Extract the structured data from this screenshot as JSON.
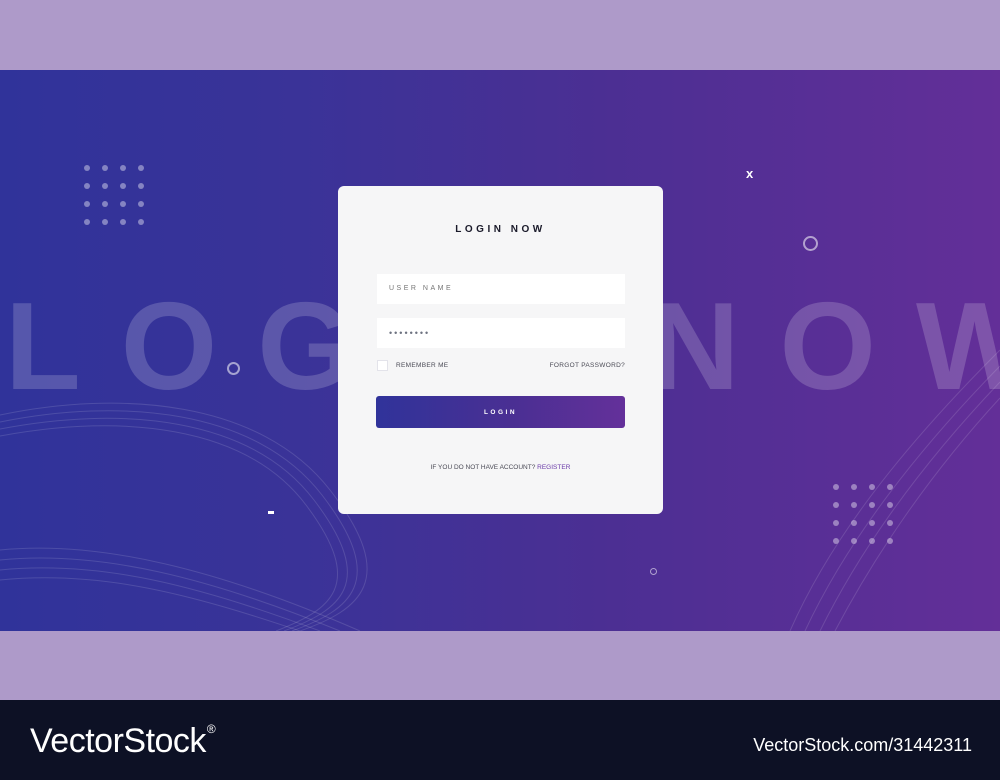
{
  "background": {
    "word_left": "LOG",
    "word_right": "NOW",
    "deco_x": "x",
    "colors": {
      "gradient_start": "#30339a",
      "gradient_end": "#632f98",
      "band": "#ae9ac9",
      "footer": "#0d1125"
    }
  },
  "login_card": {
    "title": "LOGIN NOW",
    "username_placeholder": "USER NAME",
    "password_value": "••••••••",
    "remember_label": "REMEMBER ME",
    "forgot_label": "FORGOT PASSWORD?",
    "login_button_label": "LOGIN",
    "register_prompt": "IF YOU DO NOT HAVE ACCOUNT?",
    "register_link": "REGISTER"
  },
  "footer": {
    "brand": "VectorStock",
    "registered_mark": "®",
    "stock_id": "VectorStock.com/31442311"
  }
}
